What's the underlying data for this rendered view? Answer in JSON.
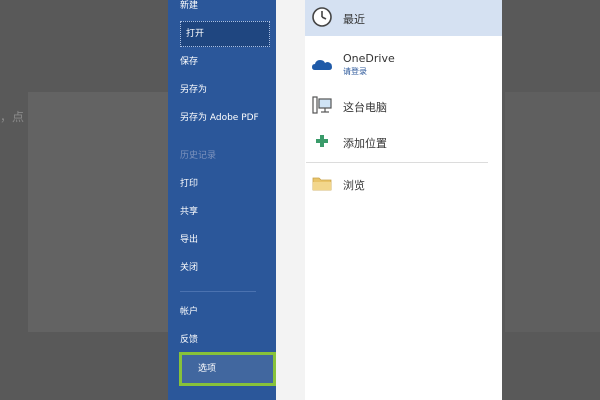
{
  "background_doc": {
    "left_text": "，点"
  },
  "nav": {
    "items": [
      {
        "label": "新建"
      },
      {
        "label": "打开"
      },
      {
        "label": "保存"
      },
      {
        "label": "另存为"
      },
      {
        "label": "另存为 Adobe PDF"
      },
      {
        "label": "历史记录"
      },
      {
        "label": "打印"
      },
      {
        "label": "共享"
      },
      {
        "label": "导出"
      },
      {
        "label": "关闭"
      },
      {
        "label": "帐户"
      },
      {
        "label": "反馈"
      },
      {
        "label": "选项"
      }
    ]
  },
  "locations": [
    {
      "label": "最近",
      "icon": "clock-icon"
    },
    {
      "label": "OneDrive",
      "sub": "请登录",
      "icon": "cloud-icon"
    },
    {
      "label": "这台电脑",
      "icon": "computer-icon"
    },
    {
      "label": "添加位置",
      "icon": "plus-icon"
    },
    {
      "label": "浏览",
      "icon": "folder-icon"
    }
  ],
  "colors": {
    "nav_bg": "#2b579a",
    "highlight_border": "#87c23a",
    "selected_location_bg": "#d5e1f2",
    "cloud": "#1f5aa8",
    "plus": "#3a9b6a",
    "folder": "#e9c46a"
  }
}
